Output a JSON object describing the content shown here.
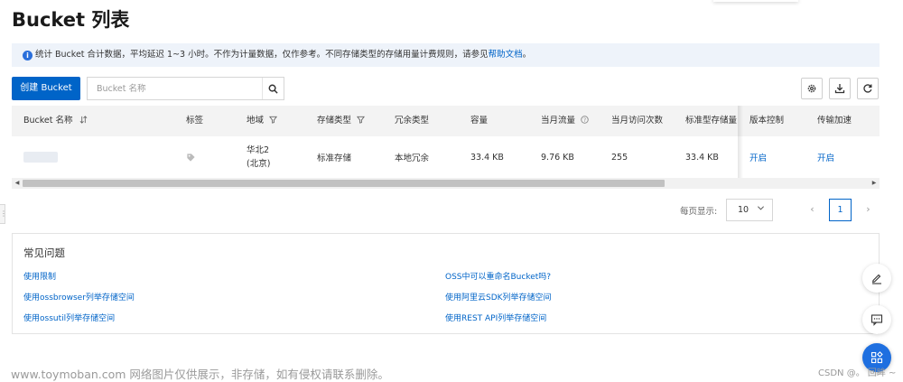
{
  "page_title": "Bucket 列表",
  "notice": {
    "text": "统计 Bucket 合计数据，平均延迟 1~3 小时。不作为计量数据，仅作参考。不同存储类型的存储用量计费规则，请参见",
    "link": "帮助文档",
    "suffix": "。"
  },
  "toolbar": {
    "create_label": "创建 Bucket",
    "search_placeholder": "Bucket 名称"
  },
  "table": {
    "headers": [
      "Bucket 名称",
      "标签",
      "地域",
      "存储类型",
      "冗余类型",
      "容量",
      "当月流量",
      "当月访问次数",
      "标准型存储量",
      "版本控制",
      "传输加速"
    ],
    "row": {
      "region_line1": "华北2",
      "region_line2": "(北京)",
      "storage_type": "标准存储",
      "redundancy": "本地冗余",
      "capacity": "33.4 KB",
      "traffic": "9.76 KB",
      "visits": "255",
      "standard_storage": "33.4 KB",
      "versioning": "开启",
      "acceleration": "开启"
    }
  },
  "pagination": {
    "per_page_label": "每页显示:",
    "per_page_value": "10",
    "current_page": "1",
    "prev_icon": "‹",
    "next_icon": "›"
  },
  "faq": {
    "title": "常见问题",
    "links": [
      "使用限制",
      "使用ossbrowser列举存储空间",
      "使用ossutil列举存储空间",
      "OSS中可以重命名Bucket吗?",
      "使用阿里云SDK列举存储空间",
      "使用REST API列举存储空间"
    ]
  },
  "footer": {
    "watermark": "www.toymoban.com 网络图片仅供展示，非存储，如有侵权请联系删除。",
    "csdn": "CSDN @。 回眸 ~"
  },
  "colors": {
    "primary": "#0064c8",
    "notice_bg": "#eef3fa",
    "header_bg": "#f3f3f3"
  },
  "icons": [
    "info-icon",
    "search-icon",
    "settings-icon",
    "download-icon",
    "refresh-icon",
    "sort-icon",
    "filter-icon",
    "help-icon",
    "tag-icon",
    "edit-icon",
    "chat-icon",
    "apps-icon"
  ]
}
